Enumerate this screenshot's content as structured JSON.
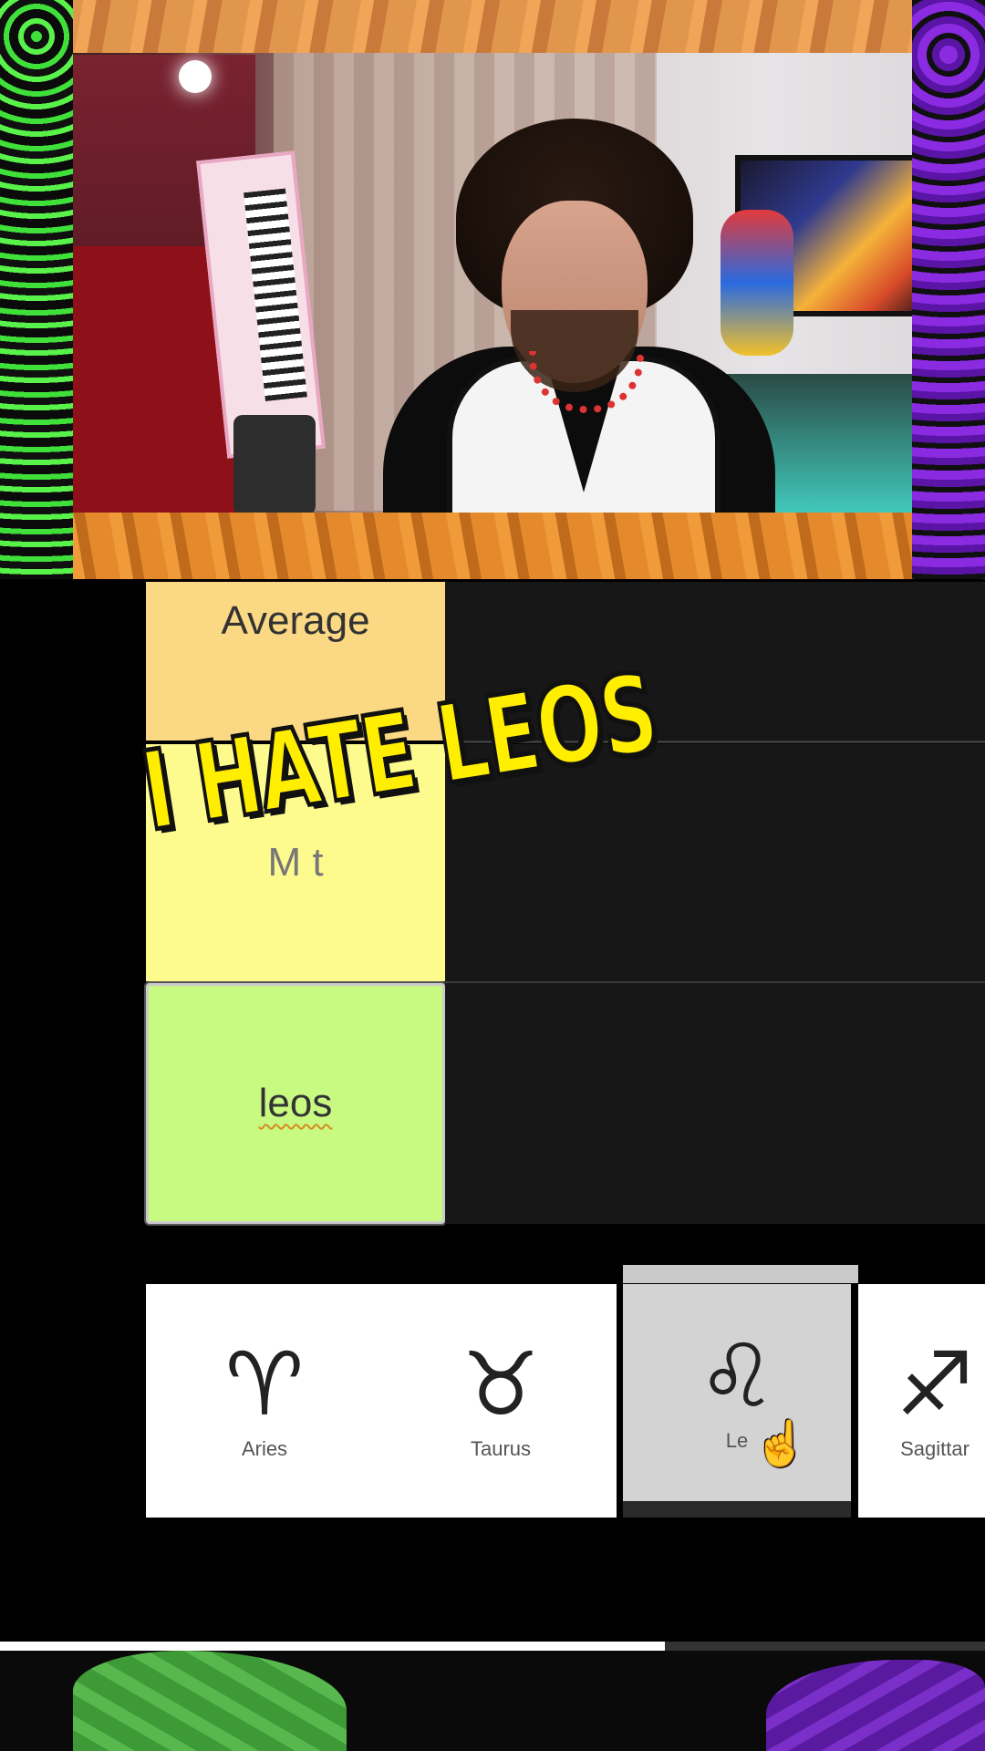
{
  "tiers": [
    {
      "label": "Average",
      "color": "#fbd984"
    },
    {
      "label": "M    t",
      "color": "#fdfb8e"
    },
    {
      "label": "leos",
      "color": "#c8fa82"
    }
  ],
  "caption": "I HATE LEOS",
  "signs": [
    {
      "glyph": "♈",
      "name": "Aries"
    },
    {
      "glyph": "♉",
      "name": "Taurus"
    },
    {
      "glyph": "♌",
      "name": "Le"
    },
    {
      "glyph": "♐",
      "name": "Sagittar"
    }
  ],
  "video": {
    "progress_percent": 67.5
  },
  "colors": {
    "caption": "#ffee00",
    "frame_orange": "#e58a2c",
    "frame_green": "#3fe03a",
    "frame_purple": "#8a2be2"
  }
}
